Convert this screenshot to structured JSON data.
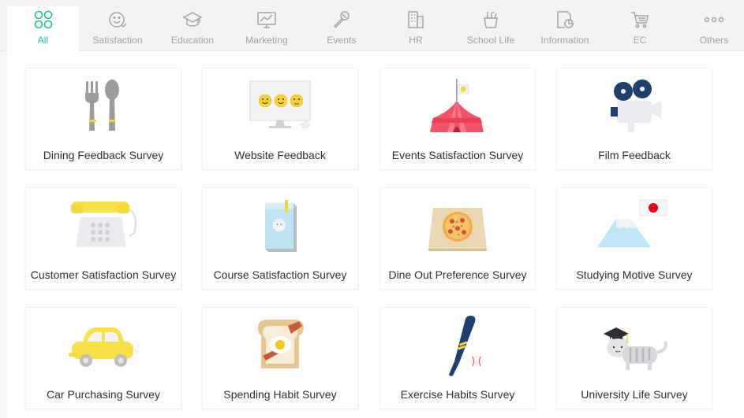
{
  "tabs": [
    {
      "label": "All",
      "icon": "grid-icon"
    },
    {
      "label": "Satisfaction",
      "icon": "smiley-icon"
    },
    {
      "label": "Education",
      "icon": "graduation-cap-icon"
    },
    {
      "label": "Marketing",
      "icon": "chart-monitor-icon"
    },
    {
      "label": "Events",
      "icon": "microphone-icon"
    },
    {
      "label": "HR",
      "icon": "building-icon"
    },
    {
      "label": "School Life",
      "icon": "pencil-cup-icon"
    },
    {
      "label": "Information",
      "icon": "info-chart-icon"
    },
    {
      "label": "EC",
      "icon": "shopping-cart-icon"
    },
    {
      "label": "Others",
      "icon": "dots-icon"
    }
  ],
  "active_tab": "All",
  "accent_color": "#1bbd9c",
  "templates": [
    {
      "title": "Dining Feedback Survey",
      "icon": "fork-spoon-icon"
    },
    {
      "title": "Website Feedback",
      "icon": "monitor-smileys-icon"
    },
    {
      "title": "Events Satisfaction Survey",
      "icon": "tent-icon"
    },
    {
      "title": "Film Feedback",
      "icon": "film-camera-icon"
    },
    {
      "title": "Customer Satisfaction Survey",
      "icon": "telephone-icon"
    },
    {
      "title": "Course Satisfaction Survey",
      "icon": "book-icon"
    },
    {
      "title": "Dine Out Preference Survey",
      "icon": "pizza-box-icon"
    },
    {
      "title": "Studying Motive Survey",
      "icon": "mount-fuji-flag-icon"
    },
    {
      "title": "Car Purchasing Survey",
      "icon": "yellow-car-icon"
    },
    {
      "title": "Spending Habit Survey",
      "icon": "toast-egg-icon"
    },
    {
      "title": "Exercise Habits Survey",
      "icon": "baseball-bat-icon"
    },
    {
      "title": "University Life Survey",
      "icon": "graduate-cat-icon"
    }
  ]
}
